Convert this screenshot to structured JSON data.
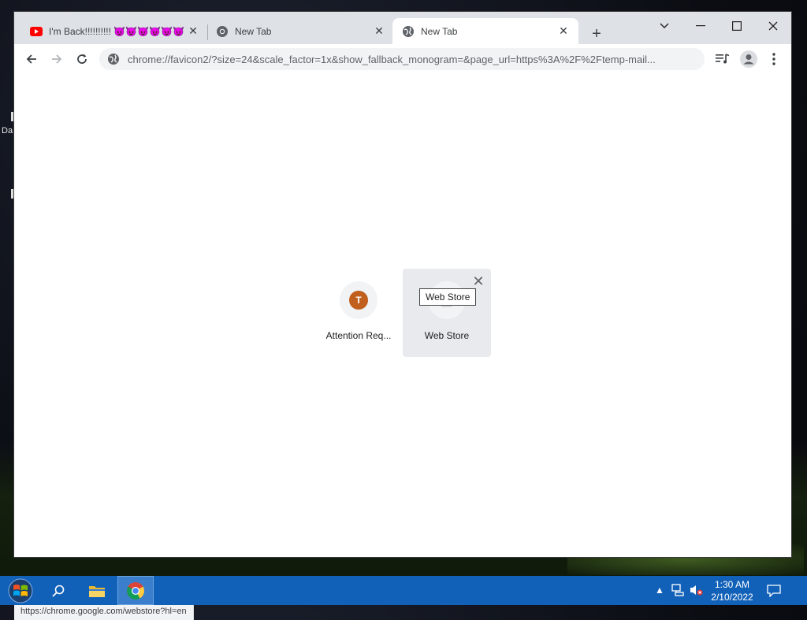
{
  "desktop": {
    "icon_text": "Da"
  },
  "browser": {
    "tabs": [
      {
        "title": "I'm Back!!!!!!!!!! 😈😈😈😈😈😈",
        "icon": "youtube-icon",
        "active": false
      },
      {
        "title": "New Tab",
        "icon": "chrome-icon",
        "active": false
      },
      {
        "title": "New Tab",
        "icon": "globe-icon",
        "active": true
      }
    ],
    "new_tab_label": "+",
    "address": "chrome://favicon2/?size=24&scale_factor=1x&show_fallback_monogram=&page_url=https%3A%2F%2Ftemp-mail..."
  },
  "page": {
    "tiles": [
      {
        "label": "Attention Req...",
        "monogram": "T",
        "monogram_color": "#c05f1e"
      },
      {
        "label": "Web Store"
      }
    ],
    "tooltip": "Web Store",
    "status_url": "https://chrome.google.com/webstore?hl=en"
  },
  "taskbar": {
    "time": "1:30 AM",
    "date": "2/10/2022"
  },
  "colors": {
    "taskbar": "#1261b8",
    "tabstrip": "#dee1e6",
    "youtube_red": "#ff0000"
  }
}
